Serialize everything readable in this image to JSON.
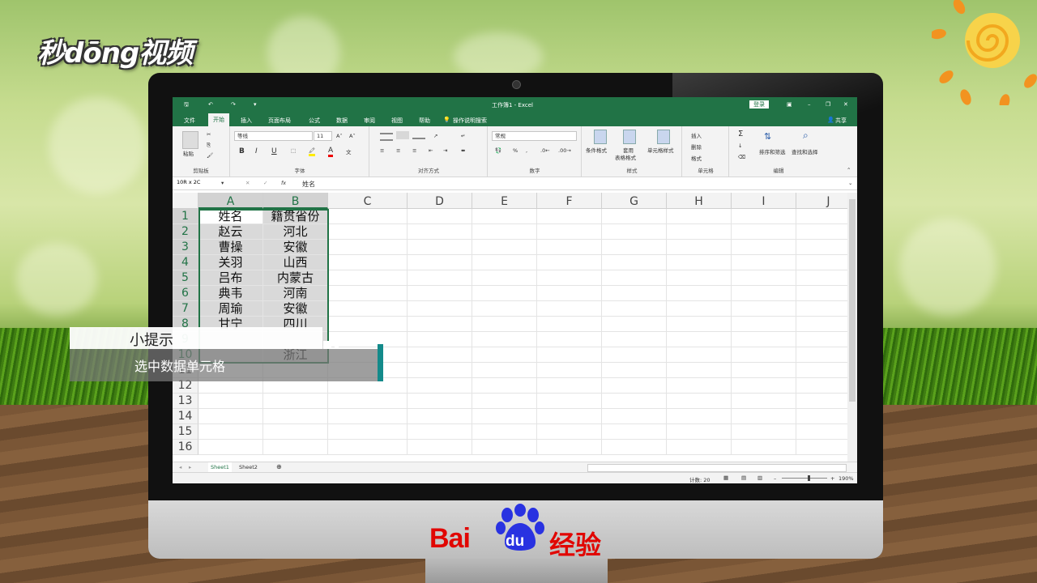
{
  "watermark": {
    "site": "秒dōng视频",
    "bottom_brand_bai": "Bai",
    "bottom_brand_du": "du",
    "bottom_brand_jingyan": "经验"
  },
  "excel": {
    "title": "工作簿1 - Excel",
    "login": "登录",
    "share": "共享",
    "tabs": [
      "文件",
      "开始",
      "插入",
      "页面布局",
      "公式",
      "数据",
      "审阅",
      "视图",
      "帮助"
    ],
    "active_tab": "开始",
    "tell_me": "操作说明搜索",
    "ribbon": {
      "paste": "粘贴",
      "clipboard": "剪贴板",
      "font_name": "等线",
      "font_size": "11",
      "font_group": "字体",
      "align_group": "对齐方式",
      "number_format": "常规",
      "number_group": "数字",
      "cond_format": "条件格式",
      "table_format_1": "套用",
      "table_format_2": "表格格式",
      "cell_style": "单元格样式",
      "styles_group": "样式",
      "insert": "插入",
      "delete": "删除",
      "format": "格式",
      "cells_group": "单元格",
      "sort_filter": "排序和筛选",
      "find_select": "查找和选择",
      "edit_group": "编辑",
      "bold": "B",
      "italic": "I",
      "underline": "U",
      "sum": "Σ"
    },
    "name_box": "10R x 2C",
    "fx": "fx",
    "formula_value": "姓名",
    "columns": [
      "A",
      "B",
      "C",
      "D",
      "E",
      "F",
      "G",
      "H",
      "I",
      "J"
    ],
    "rows": [
      "1",
      "2",
      "3",
      "4",
      "5",
      "6",
      "7",
      "8",
      "9",
      "10",
      "11",
      "12",
      "13",
      "14",
      "15",
      "16"
    ],
    "data": [
      [
        "姓名",
        "籍贯省份"
      ],
      [
        "赵云",
        "河北"
      ],
      [
        "曹操",
        "安徽"
      ],
      [
        "关羽",
        "山西"
      ],
      [
        "吕布",
        "内蒙古"
      ],
      [
        "典韦",
        "河南"
      ],
      [
        "周瑜",
        "安徽"
      ],
      [
        "甘宁",
        "四川"
      ],
      [
        "",
        ""
      ],
      [
        "",
        "浙江"
      ]
    ],
    "sheets": [
      "Sheet1",
      "Sheet2"
    ],
    "active_sheet": "Sheet1",
    "status_count": "计数: 20",
    "zoom": "190%"
  },
  "tip": {
    "title": "小提示",
    "body": "选中数据单元格"
  },
  "colors": {
    "excel_green": "#217346",
    "brand_red": "#e10602",
    "tip_accent": "#138a8a"
  }
}
